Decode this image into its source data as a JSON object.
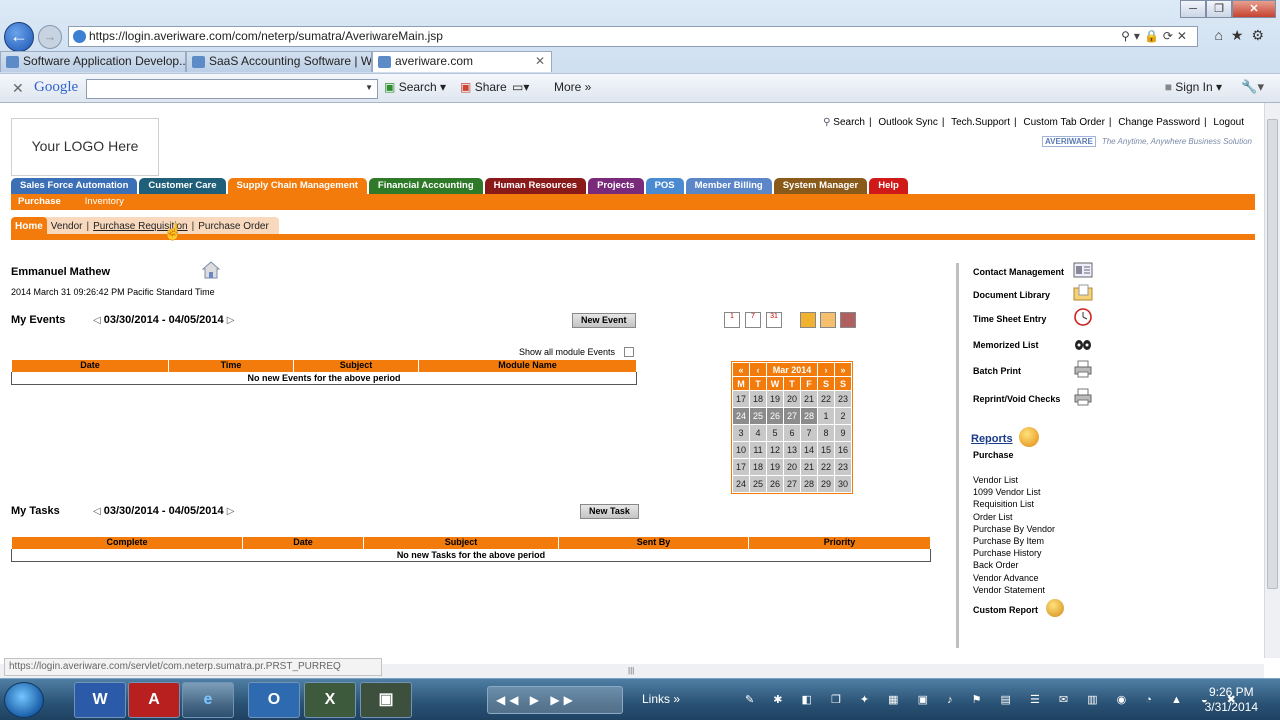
{
  "browser": {
    "url": "https://login.averiware.com/com/neterp/sumatra/AveriwareMain.jsp",
    "tabs": [
      {
        "label": "Software Application Develop..."
      },
      {
        "label": "SaaS Accounting Software | W..."
      },
      {
        "label": "averiware.com"
      }
    ],
    "window_buttons": {
      "minimize": "─",
      "maximize": "❐",
      "close": "✕"
    },
    "back": "←",
    "forward": "→",
    "addr_tools": "⚲▾🔒⟳✕",
    "chrome_right": "⌂★⚙",
    "toolbar": {
      "close": "✕",
      "google_label": "Google",
      "search_dropdown": "▼",
      "search_label": "Search",
      "share_label": "Share",
      "more_label": "More »",
      "signin_label": "Sign In",
      "wrench": "🔧▾"
    },
    "status_url": "https://login.averiware.com/servlet/com.neterp.sumatra.pr.PRST_PURREQ"
  },
  "app": {
    "logo_text": "Your LOGO Here",
    "top_links": [
      "Search",
      "Outlook Sync",
      "Tech.Support",
      "Custom Tab Order",
      "Change Password",
      "Logout"
    ],
    "brand": {
      "mark": "AVERIWARE",
      "tagline": "The Anytime, Anywhere Business Solution"
    },
    "modules": [
      {
        "label": "Sales Force Automation",
        "color": "#3b6fb6"
      },
      {
        "label": "Customer Care",
        "color": "#1f5f7a"
      },
      {
        "label": "Supply Chain Management",
        "color": "#f27b0b"
      },
      {
        "label": "Financial Accounting",
        "color": "#2e7a28"
      },
      {
        "label": "Human Resources",
        "color": "#8a1a1a"
      },
      {
        "label": "Projects",
        "color": "#7a2a7a"
      },
      {
        "label": "POS",
        "color": "#4a8ad0"
      },
      {
        "label": "Member Billing",
        "color": "#5b86c8"
      },
      {
        "label": "System Manager",
        "color": "#8a5a1a"
      },
      {
        "label": "Help",
        "color": "#d01a1a"
      }
    ],
    "submodules": [
      "Purchase",
      "Inventory"
    ],
    "nav_tabs": [
      "Home",
      "Vendor",
      "Purchase Requisition",
      "Purchase Order"
    ],
    "user_name": "Emmanuel Mathew",
    "datetime": "2014 March 31 09:26:42 PM Pacific Standard Time",
    "events": {
      "title": "My Events",
      "period": "03/30/2014 - 04/05/2014",
      "prev": "◁",
      "next": "▷",
      "new_button": "New Event",
      "show_all_label": "Show all module Events",
      "columns": [
        "Date",
        "Time",
        "Subject",
        "Module Name"
      ],
      "empty_text": "No new Events for the above period"
    },
    "tasks": {
      "title": "My Tasks",
      "period": "03/30/2014 - 04/05/2014",
      "prev": "◁",
      "next": "▷",
      "new_button": "New Task",
      "columns": [
        "Complete",
        "Date",
        "Subject",
        "Sent By",
        "Priority"
      ],
      "empty_text": "No new Tasks for the above period"
    },
    "cal_icon_labels": [
      "1",
      "7",
      "31"
    ],
    "calendar": {
      "nav": [
        "«",
        "‹",
        "Mar 2014",
        "›",
        "»"
      ],
      "dow": [
        "M",
        "T",
        "W",
        "T",
        "F",
        "S",
        "S"
      ],
      "weeks": [
        [
          "17",
          "18",
          "19",
          "20",
          "21",
          "22",
          "23"
        ],
        [
          "24",
          "25",
          "26",
          "27",
          "28",
          "1",
          "2"
        ],
        [
          "3",
          "4",
          "5",
          "6",
          "7",
          "8",
          "9"
        ],
        [
          "10",
          "11",
          "12",
          "13",
          "14",
          "15",
          "16"
        ],
        [
          "17",
          "18",
          "19",
          "20",
          "21",
          "22",
          "23"
        ],
        [
          "24",
          "25",
          "26",
          "27",
          "28",
          "29",
          "30"
        ]
      ]
    },
    "right_links": [
      "Contact Management",
      "Document Library",
      "Time Sheet Entry",
      "Memorized List",
      "Batch Print",
      "Reprint/Void Checks"
    ],
    "reports": {
      "title": "Reports",
      "section": "Purchase",
      "items": [
        "Vendor List",
        "1099 Vendor List",
        "Requisition List",
        "Order List",
        "Purchase By Vendor",
        "Purchase By Item",
        "Purchase History",
        "Back Order",
        "Vendor Advance",
        "Vendor Statement"
      ],
      "custom": "Custom Report"
    }
  },
  "taskbar": {
    "media_controls": "◀◀ ▶ ▶▶",
    "links_label": "Links",
    "links_chevron": "»",
    "tray_glyphs": "✎ ✱ ◧ ❐ ✦ ▦ ▣ ♪ ⚑ ▤ ☰ ✉ ▥ ◉ ◔ ▲ ◒ ✖",
    "time": "9:26 PM",
    "date": "3/31/2014",
    "apps": [
      {
        "label": "W"
      },
      {
        "label": "A"
      },
      {
        "label": "e"
      },
      {
        "label": "O"
      },
      {
        "label": "X"
      },
      {
        "label": "▣"
      }
    ]
  }
}
